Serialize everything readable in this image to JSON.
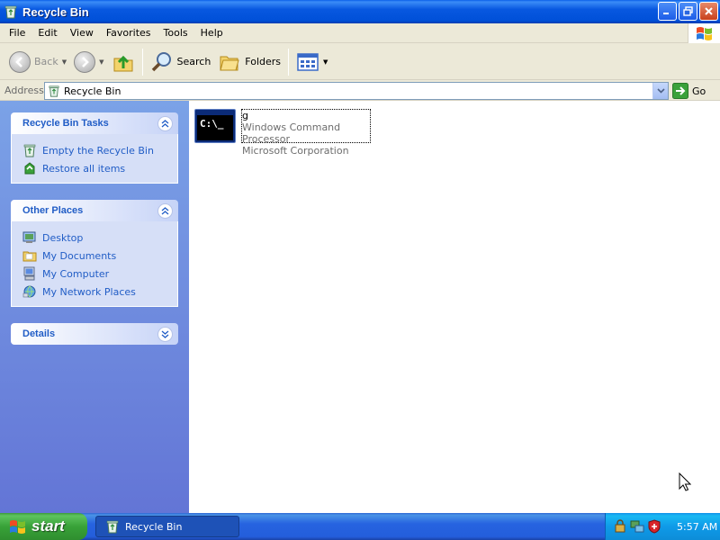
{
  "window": {
    "title": "Recycle Bin"
  },
  "menu": {
    "items": [
      "File",
      "Edit",
      "View",
      "Favorites",
      "Tools",
      "Help"
    ]
  },
  "toolbar": {
    "back_label": "Back",
    "search_label": "Search",
    "folders_label": "Folders"
  },
  "address": {
    "label": "Address",
    "value": "Recycle Bin",
    "go_label": "Go"
  },
  "taskpane": {
    "tasks": {
      "title": "Recycle Bin Tasks",
      "links": [
        "Empty the Recycle Bin",
        "Restore all items"
      ]
    },
    "places": {
      "title": "Other Places",
      "links": [
        "Desktop",
        "My Documents",
        "My Computer",
        "My Network Places"
      ]
    },
    "details": {
      "title": "Details"
    }
  },
  "files": [
    {
      "name": "g",
      "description": "Windows Command Processor",
      "company": "Microsoft Corporation",
      "icon": "cmd-icon"
    }
  ],
  "taskbar": {
    "start_label": "start",
    "task_label": "Recycle Bin",
    "clock": "5:57 AM"
  },
  "colors": {
    "titlebar": "#0050d8",
    "taskpane_link": "#215dc6",
    "start_green": "#38a238",
    "tray_blue": "#0f9ae8"
  }
}
